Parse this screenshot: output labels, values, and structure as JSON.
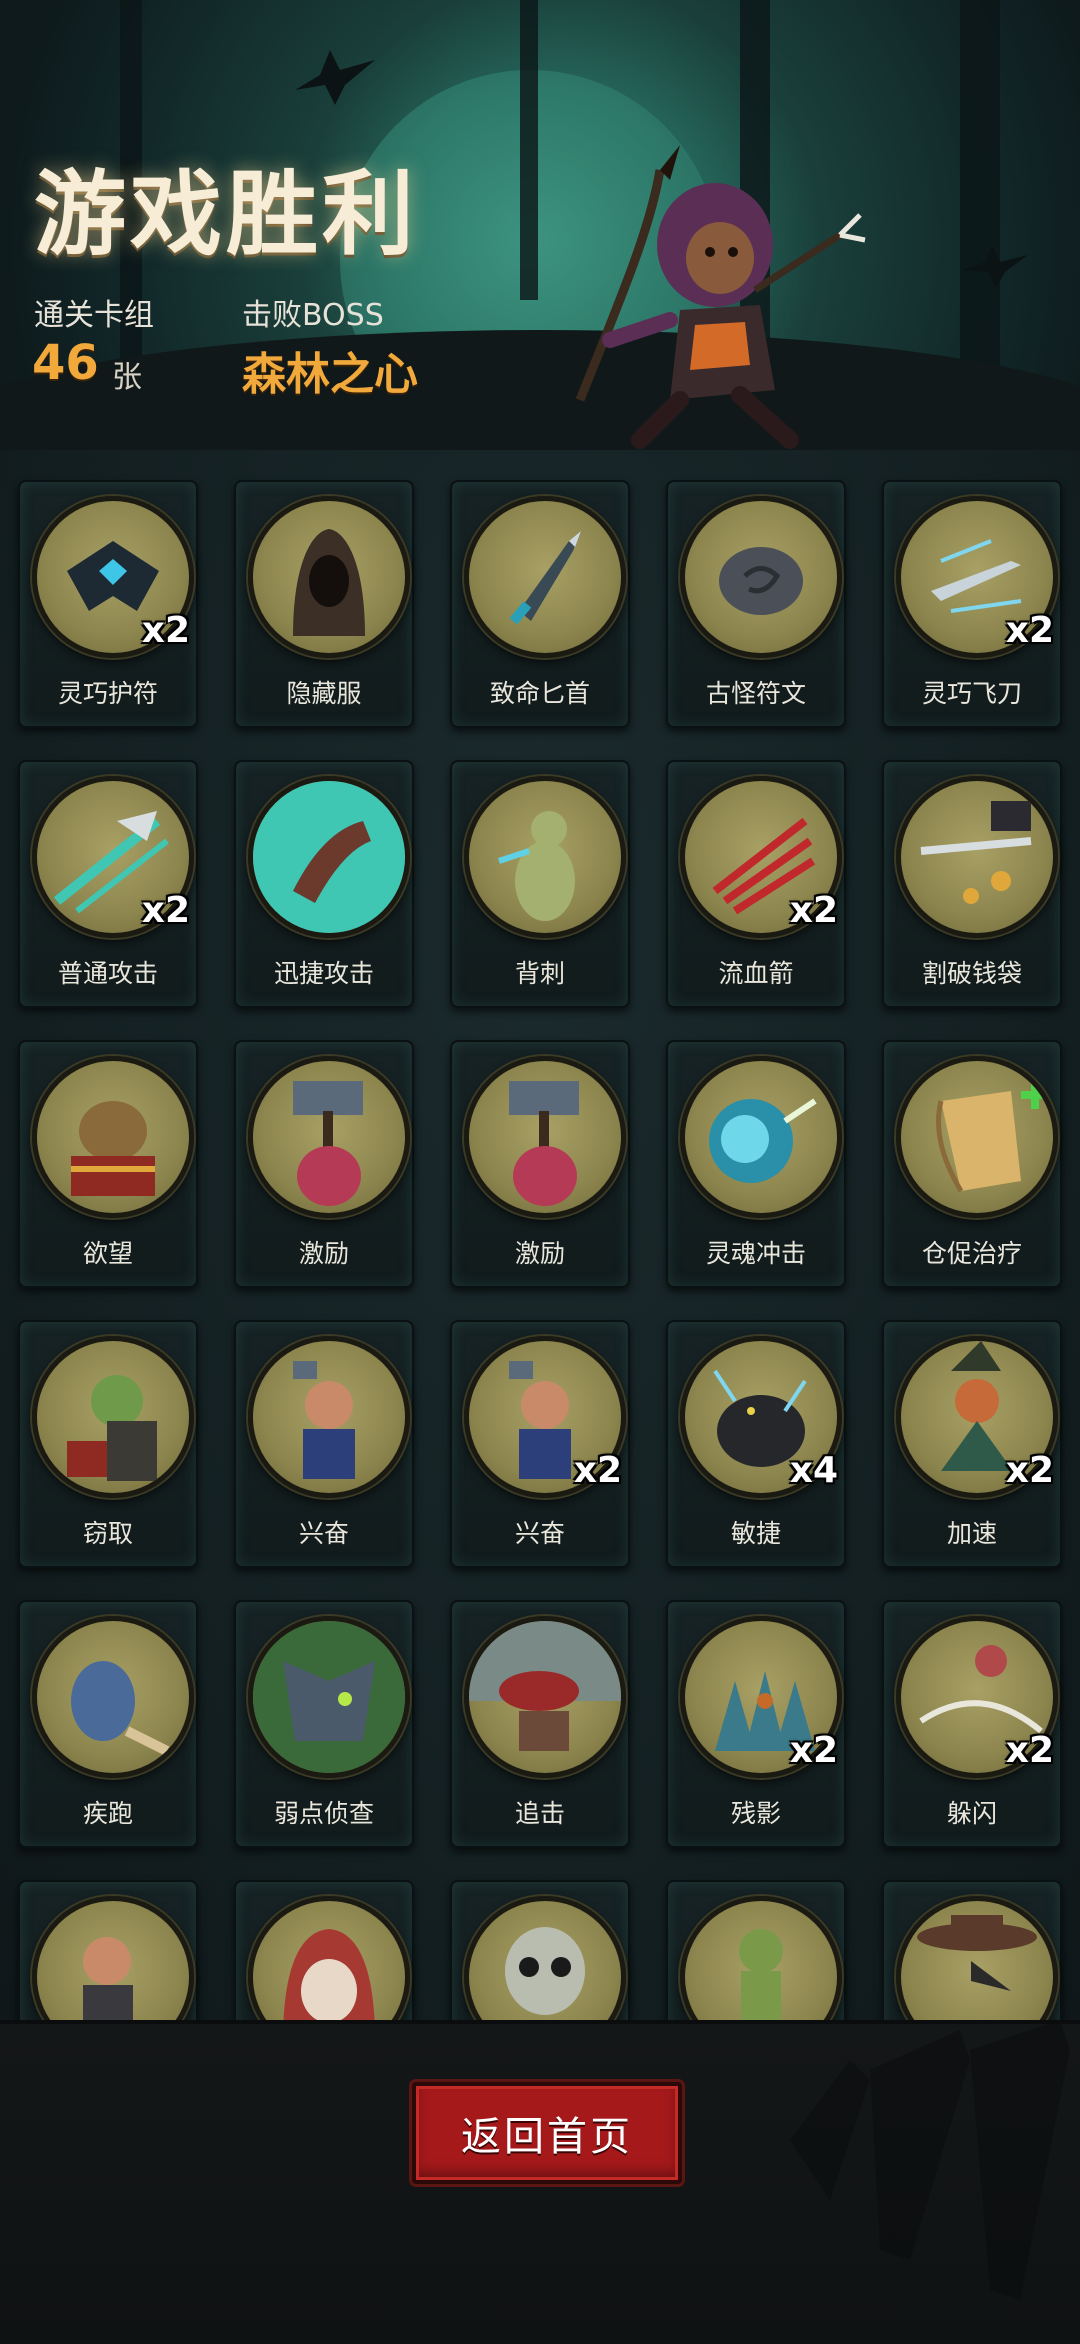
{
  "header": {
    "title": "游戏胜利",
    "deck_label": "通关卡组",
    "deck_count": "46",
    "deck_unit": "张",
    "boss_label": "击败BOSS",
    "boss_name": "森林之心"
  },
  "cards": [
    {
      "name": "灵巧护符",
      "count": "x2",
      "icon": "amulet-icon"
    },
    {
      "name": "隐藏服",
      "count": "",
      "icon": "hood-icon"
    },
    {
      "name": "致命匕首",
      "count": "",
      "icon": "dagger-icon"
    },
    {
      "name": "古怪符文",
      "count": "",
      "icon": "rune-stone-icon"
    },
    {
      "name": "灵巧飞刀",
      "count": "x2",
      "icon": "throwing-knife-icon"
    },
    {
      "name": "普通攻击",
      "count": "x2",
      "icon": "slash-icon"
    },
    {
      "name": "迅捷攻击",
      "count": "",
      "icon": "quick-strike-icon"
    },
    {
      "name": "背刺",
      "count": "",
      "icon": "backstab-icon"
    },
    {
      "name": "流血箭",
      "count": "x2",
      "icon": "bleed-arrow-icon"
    },
    {
      "name": "割破钱袋",
      "count": "",
      "icon": "cut-purse-icon"
    },
    {
      "name": "欲望",
      "count": "",
      "icon": "greed-icon"
    },
    {
      "name": "激励",
      "count": "",
      "icon": "hammer-warrior-icon"
    },
    {
      "name": "激励",
      "count": "",
      "icon": "hammer-warrior-icon"
    },
    {
      "name": "灵魂冲击",
      "count": "",
      "icon": "soul-blast-icon"
    },
    {
      "name": "仓促治疗",
      "count": "",
      "icon": "scroll-heal-icon"
    },
    {
      "name": "窃取",
      "count": "",
      "icon": "goblin-thief-icon"
    },
    {
      "name": "兴奋",
      "count": "",
      "icon": "excited-dwarf-icon"
    },
    {
      "name": "兴奋",
      "count": "x2",
      "icon": "excited-dwarf-icon"
    },
    {
      "name": "敏捷",
      "count": "x4",
      "icon": "panther-icon"
    },
    {
      "name": "加速",
      "count": "x2",
      "icon": "witch-icon"
    },
    {
      "name": "疾跑",
      "count": "",
      "icon": "running-beast-icon"
    },
    {
      "name": "弱点侦查",
      "count": "",
      "icon": "wolf-icon"
    },
    {
      "name": "追击",
      "count": "",
      "icon": "pursuit-icon"
    },
    {
      "name": "残影",
      "count": "x2",
      "icon": "afterimage-icon"
    },
    {
      "name": "躲闪",
      "count": "x2",
      "icon": "dodge-icon"
    },
    {
      "name": "",
      "count": "",
      "icon": "dwarf-warrior-icon"
    },
    {
      "name": "",
      "count": "",
      "icon": "red-hood-icon"
    },
    {
      "name": "",
      "count": "",
      "icon": "skull-icon"
    },
    {
      "name": "",
      "count": "",
      "icon": "goblin-icon"
    },
    {
      "name": "",
      "count": "",
      "icon": "plague-doctor-icon"
    }
  ],
  "footer": {
    "home_button": "返回首页"
  },
  "colors": {
    "accent_orange": "#f2a93c",
    "button_red": "#a5191b",
    "medal_olive": "#8c854e"
  }
}
